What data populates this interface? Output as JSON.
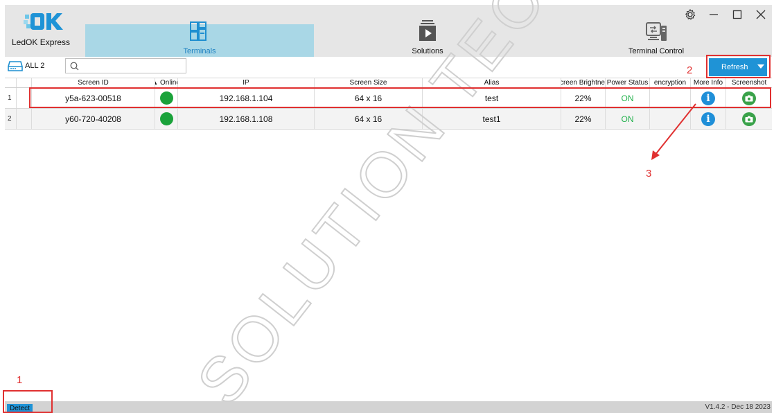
{
  "app": {
    "name": "LedOK Express",
    "version": "V1.4.2 - Dec 18 2023"
  },
  "nav": [
    {
      "label": "Terminals",
      "icon": "terminals-icon",
      "active": true
    },
    {
      "label": "Solutions",
      "icon": "solutions-icon",
      "active": false
    },
    {
      "label": "Terminal Control",
      "icon": "terminal-control-icon",
      "active": false
    }
  ],
  "toolbar": {
    "all_label": "ALL 2",
    "search_placeholder": "",
    "refresh_label": "Refresh"
  },
  "table": {
    "columns": [
      "Screen ID",
      "Online",
      "IP",
      "Screen Size",
      "Alias",
      "creen Brightne",
      "Power Status",
      "encryption",
      "More Info",
      "Screenshot"
    ],
    "rows": [
      {
        "num": "1",
        "screen_id": "y5a-623-00518",
        "online": true,
        "ip": "192.168.1.104",
        "size": "64 x 16",
        "alias": "test",
        "brightness": "22%",
        "power": "ON",
        "encryption": ""
      },
      {
        "num": "2",
        "screen_id": "y60-720-40208",
        "online": true,
        "ip": "192.168.1.108",
        "size": "64 x 16",
        "alias": "test1",
        "brightness": "22%",
        "power": "ON",
        "encryption": ""
      }
    ]
  },
  "status": {
    "detect_label": "Detect"
  },
  "annotations": [
    "1",
    "2",
    "3"
  ],
  "watermark": "SOLUTION TECHNOLOGY",
  "colors": {
    "accent": "#1f93d6",
    "active_tab": "#a9d7e6",
    "annotation": "#e03030",
    "online": "#1aa23a"
  }
}
